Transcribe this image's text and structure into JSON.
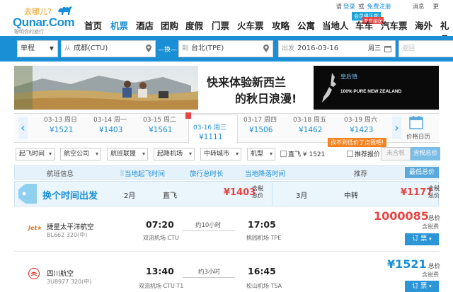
{
  "header": {
    "logo_tag": "去哪儿?",
    "logo": "Qunar.Com",
    "logo_sub": "聪明你的旅行",
    "top_links": {
      "login": "请",
      "login_link": "登录",
      "or": "或",
      "register": "免费注册",
      "messages": "消息",
      "more": "更"
    },
    "member_badge": "会员俱乐部",
    "zhuanche_badge": "专车接送",
    "nav": [
      "首页",
      "机票",
      "酒店",
      "团购",
      "度假",
      "门票",
      "火车票",
      "攻略",
      "公寓",
      "当地人",
      "车车",
      "汽车票",
      "海外",
      "礼品"
    ]
  },
  "search": {
    "trip_type": "单程",
    "from_hint": "从",
    "from_value": "成都(CTU)",
    "swap": "—换—",
    "to_hint": "到",
    "to_value": "台北(TPE)",
    "depart_hint": "出发",
    "depart_value": "2016-03-16",
    "depart_week": "周三",
    "return_hint": "返回"
  },
  "banner": {
    "headline_1": "快来体验新西兰",
    "headline_2": "的秋日浪漫!",
    "brand": "皇后镇",
    "brand_en": "100% PURE NEW ZEALAND"
  },
  "dates": [
    {
      "date": "03-13 周日",
      "price": "¥1521"
    },
    {
      "date": "03-14 周一",
      "price": "¥1403"
    },
    {
      "date": "03-15 周二",
      "price": "¥1561"
    },
    {
      "date": "03-16 周三",
      "price": "¥1111"
    },
    {
      "date": "03-17 周四",
      "price": "¥1506"
    },
    {
      "date": "03-18 周五",
      "price": "¥1462"
    },
    {
      "date": "03-19 周六",
      "price": "¥1423"
    }
  ],
  "calendar_label": "价格日历",
  "hint_tip": "找不到低价了点我吧!",
  "filters": {
    "dropdowns": [
      "起飞时间",
      "航空公司",
      "航班联盟",
      "起降机场",
      "中转城市",
      "机型"
    ],
    "direct_label": "直飞",
    "direct_price": "¥ 1521",
    "recommend_label": "推荐报价",
    "tax_off": "未含税",
    "tax_on": "含税总价"
  },
  "columns": [
    "航班信息",
    "当地起飞时间",
    "旅行总时长",
    "当地降落时间",
    "推荐",
    "最低总价"
  ],
  "promo": {
    "title": "换个时间出发",
    "left_month": "2月",
    "left_type": "直飞",
    "left_price": "¥1403",
    "left_tax_1": "含税",
    "left_tax_2": "总价",
    "right_month": "3月",
    "right_type": "中转",
    "right_price": "¥1177",
    "right_tax_1": "含税",
    "right_tax_2": "总价"
  },
  "flights": [
    {
      "logo": "Jet★",
      "airline": "捷星太平洋航空",
      "code": "BL662 320(中)",
      "dep_time": "07:20",
      "dep_airport": "双流机场 CTU",
      "duration": "约10小时",
      "arr_time": "17:05",
      "arr_airport": "桃园机场 TPE",
      "price": "1000085",
      "price_suffix": "总价",
      "tax_note": "含税费",
      "book": "订 票"
    },
    {
      "logo": "✈",
      "airline": "四川航空",
      "code": "3U8977 320(中)",
      "dep_time": "13:40",
      "dep_airport": "双流机场 CTU T1",
      "duration": "约3小时",
      "arr_time": "16:45",
      "arr_airport": "松山机场 TSA",
      "price": "¥1521",
      "price_suffix": "总价",
      "tax_note": "含税费",
      "book": "订 票"
    }
  ],
  "colors": {
    "brand_blue": "#1a8fd6",
    "price_red": "#e64545",
    "header_bg": "#1a8fd6"
  }
}
